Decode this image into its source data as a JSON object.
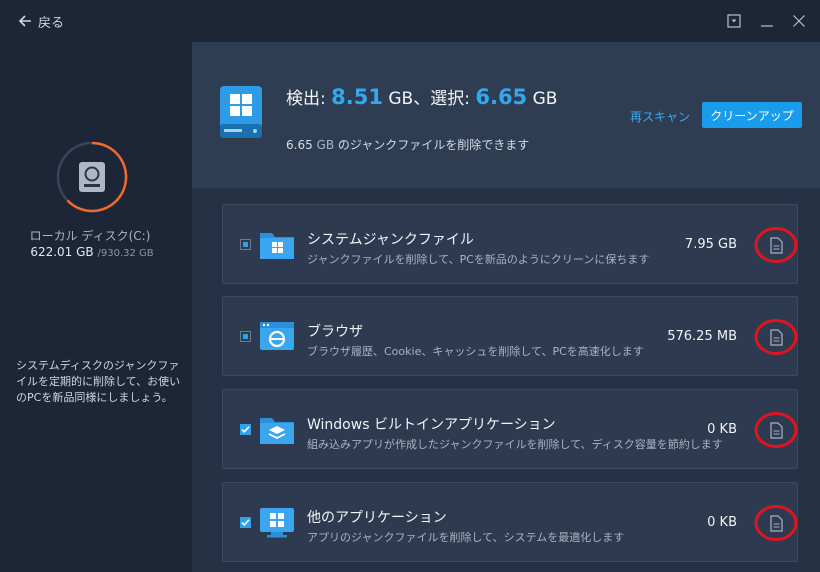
{
  "titlebar": {
    "back_label": "戻る"
  },
  "sidebar": {
    "drive_name": "ローカル ディスク(C:)",
    "used": "622.01 GB",
    "total": "/930.32 GB",
    "description": "システムディスクのジャンクファイルを定期的に削除して、お使いのPCを新品同様にしましょう。"
  },
  "summary": {
    "detected_label": "検出: ",
    "detected_value": "8.51",
    "detected_unit": " GB、",
    "selected_label": "選択: ",
    "selected_value": "6.65",
    "selected_unit": " GB",
    "deletable_value": "6.65",
    "deletable_unit": " GB ",
    "deletable_text": "のジャンクファイルを削除できます",
    "rescan_label": "再スキャン",
    "cleanup_label": "クリーンアップ"
  },
  "categories": [
    {
      "title": "システムジャンクファイル",
      "description": "ジャンクファイルを削除して、PCを新品のようにクリーンに保ちます",
      "size": "7.95 GB",
      "state": "partial",
      "icon": "folder-windows-icon"
    },
    {
      "title": "ブラウザ",
      "description": "ブラウザ履歴、Cookie、キャッシュを削除して、PCを高速化します",
      "size": "576.25 MB",
      "state": "partial",
      "icon": "browser-icon"
    },
    {
      "title": "Windows ビルトインアプリケーション",
      "description": "組み込みアプリが作成したジャンクファイルを削除して、ディスク容量を節約します",
      "size": "0 KB",
      "state": "checked",
      "icon": "folder-layers-icon"
    },
    {
      "title": "他のアプリケーション",
      "description": "アプリのジャンクファイルを削除して、システムを最適化します",
      "size": "0 KB",
      "state": "checked",
      "icon": "monitor-apps-icon"
    }
  ],
  "colors": {
    "accent": "#1a9cec",
    "highlight_circle": "#e0141e",
    "ring": "#f06a2c"
  }
}
